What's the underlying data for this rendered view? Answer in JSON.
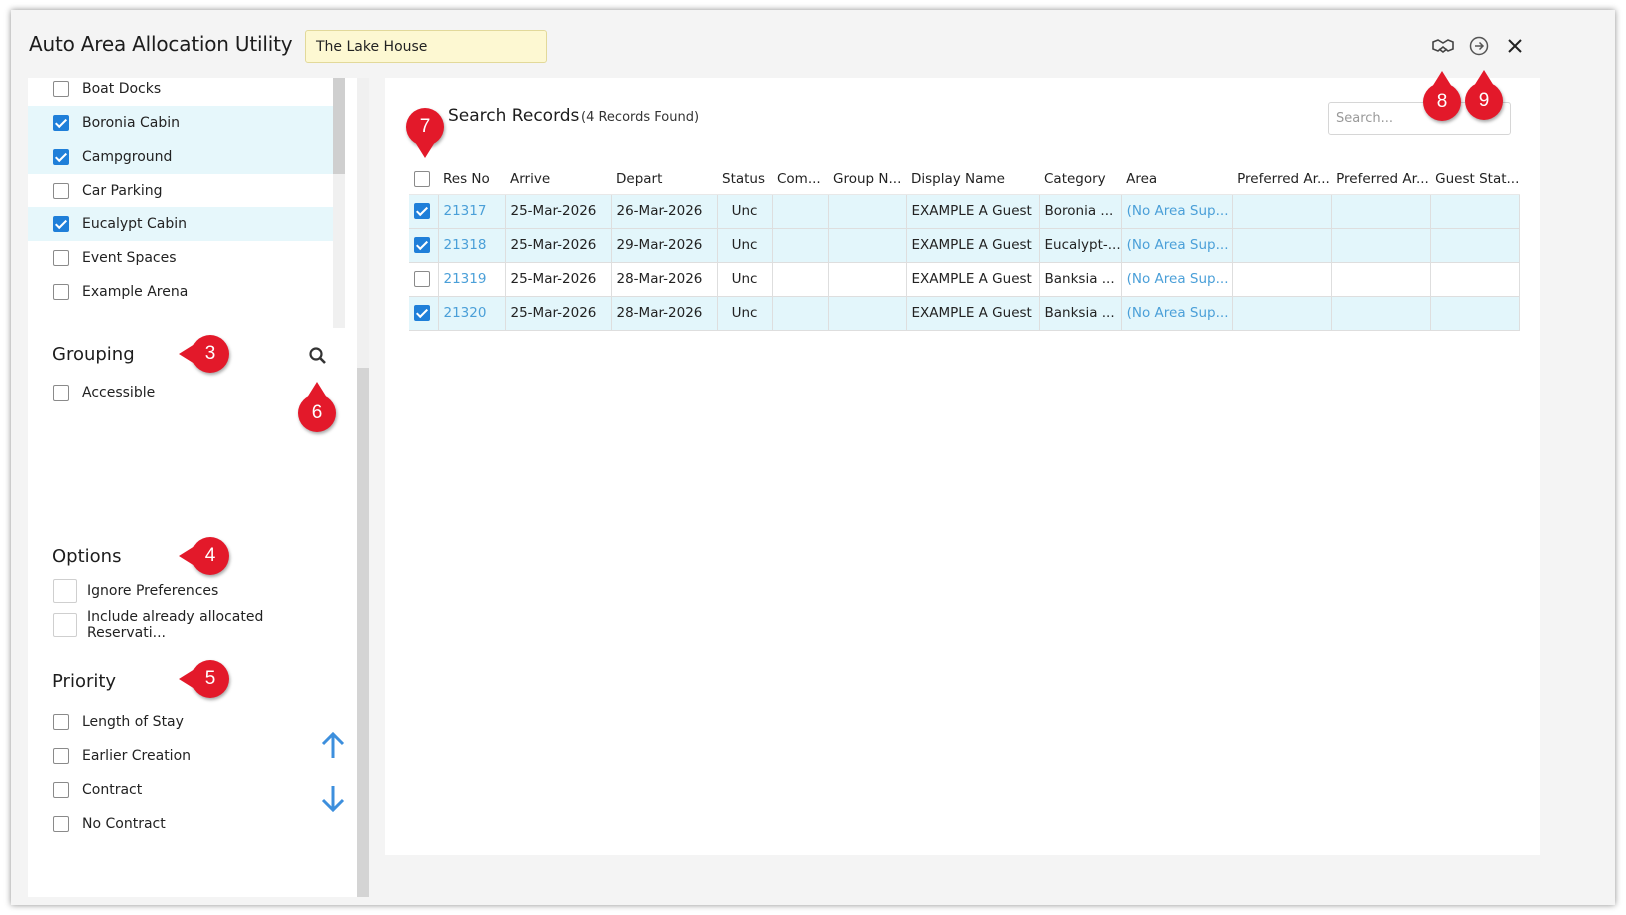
{
  "window": {
    "title": "Auto Area Allocation Utility",
    "property": "The Lake House"
  },
  "icons": {
    "handshake": "handshake-icon",
    "proceed": "arrow-right-circle-icon",
    "close": "close-icon",
    "search": "search-icon",
    "up": "arrow-up-icon",
    "down": "arrow-down-icon"
  },
  "categories": [
    {
      "label": "Boat Docks",
      "checked": false
    },
    {
      "label": "Boronia Cabin",
      "checked": true
    },
    {
      "label": "Campground",
      "checked": true
    },
    {
      "label": "Car Parking",
      "checked": false
    },
    {
      "label": "Eucalypt Cabin",
      "checked": true
    },
    {
      "label": "Event Spaces",
      "checked": false
    },
    {
      "label": "Example Arena",
      "checked": false
    }
  ],
  "grouping": {
    "heading": "Grouping",
    "items": [
      {
        "label": "Accessible",
        "checked": false
      }
    ]
  },
  "options": {
    "heading": "Options",
    "items": [
      {
        "label": "Ignore Preferences"
      },
      {
        "label": "Include already allocated Reservati..."
      }
    ]
  },
  "priority": {
    "heading": "Priority",
    "items": [
      {
        "label": "Length of Stay"
      },
      {
        "label": "Earlier Creation"
      },
      {
        "label": "Contract"
      },
      {
        "label": "No Contract"
      }
    ]
  },
  "search": {
    "title": "Search Records",
    "count": "(4 Records Found)",
    "placeholder": "Search..."
  },
  "table": {
    "headers": [
      "Res No",
      "Arrive",
      "Depart",
      "Status",
      "Com...",
      "Group N...",
      "Display Name",
      "Category",
      "Area",
      "Preferred Ar...",
      "Preferred Ar...",
      "Guest Stat..."
    ],
    "rows": [
      {
        "checked": true,
        "res": "21317",
        "arrive": "25-Mar-2026",
        "depart": "26-Mar-2026",
        "status": "Unc",
        "com": "",
        "group": "",
        "name": "EXAMPLE A Guest",
        "category": "Boronia ...",
        "area": "(No Area Sup...",
        "pref1": "",
        "pref2": "",
        "guest": ""
      },
      {
        "checked": true,
        "res": "21318",
        "arrive": "25-Mar-2026",
        "depart": "29-Mar-2026",
        "status": "Unc",
        "com": "",
        "group": "",
        "name": "EXAMPLE A Guest",
        "category": "Eucalypt-...",
        "area": "(No Area Sup...",
        "pref1": "",
        "pref2": "",
        "guest": ""
      },
      {
        "checked": false,
        "res": "21319",
        "arrive": "25-Mar-2026",
        "depart": "28-Mar-2026",
        "status": "Unc",
        "com": "",
        "group": "",
        "name": "EXAMPLE A Guest",
        "category": "Banksia ...",
        "area": "(No Area Sup...",
        "pref1": "",
        "pref2": "",
        "guest": ""
      },
      {
        "checked": true,
        "res": "21320",
        "arrive": "25-Mar-2026",
        "depart": "28-Mar-2026",
        "status": "Unc",
        "com": "",
        "group": "",
        "name": "EXAMPLE A Guest",
        "category": "Banksia ...",
        "area": "(No Area Sup...",
        "pref1": "",
        "pref2": "",
        "guest": ""
      }
    ]
  },
  "callouts": [
    "3",
    "4",
    "5",
    "6",
    "7",
    "8",
    "9"
  ],
  "colors": {
    "accent": "#1f7fd9",
    "selected_row": "#e3f6fb",
    "callout": "#e3192a",
    "link": "#4a9fd8",
    "property_bg": "#fdf8d2"
  }
}
